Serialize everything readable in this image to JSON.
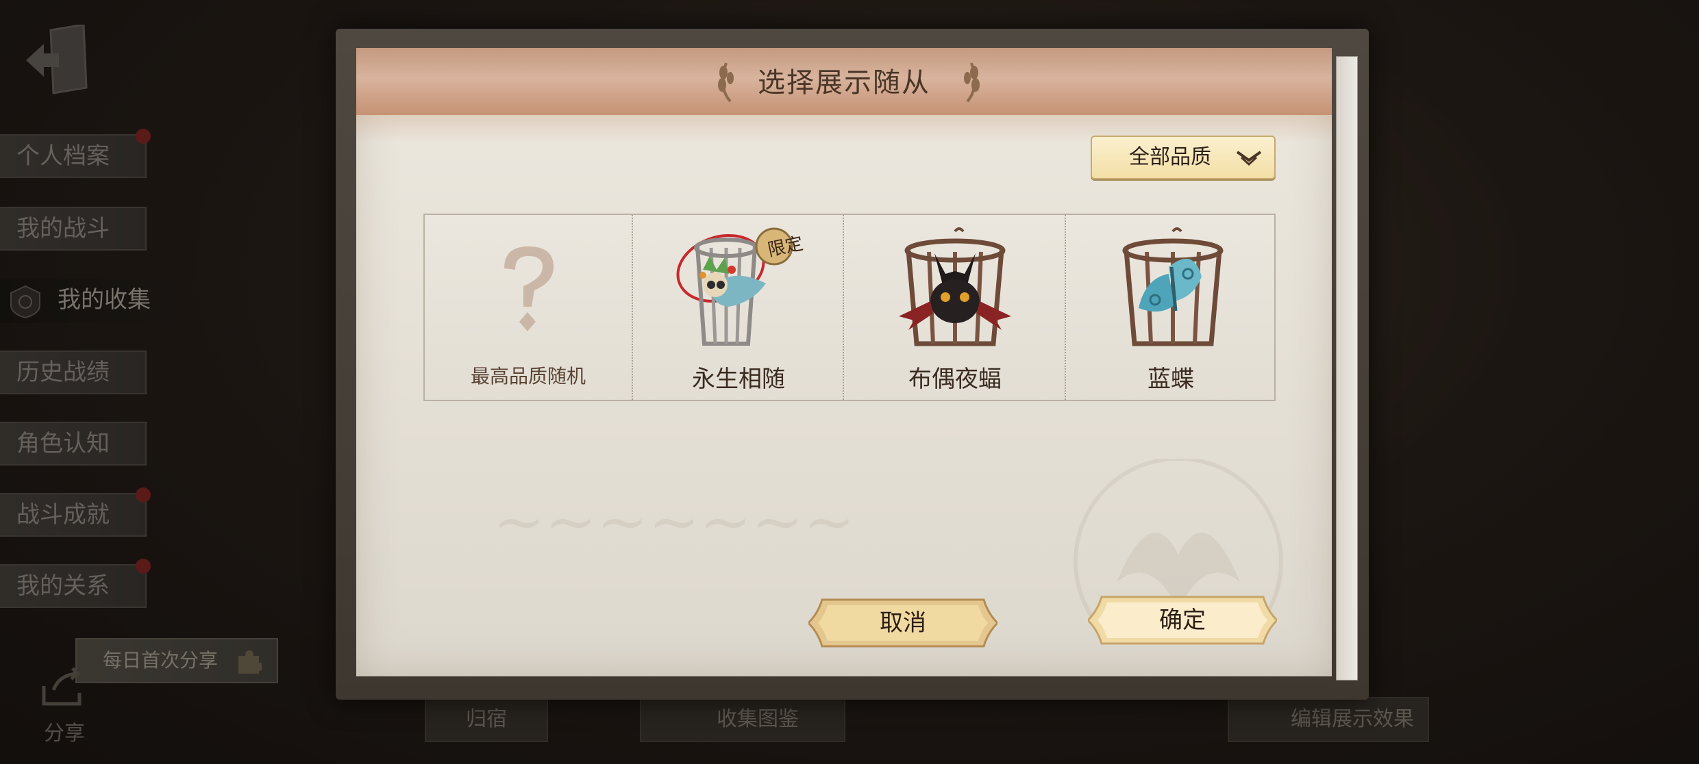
{
  "sidebar": {
    "items": [
      {
        "label": "个人档案",
        "badge": true
      },
      {
        "label": "我的战斗",
        "badge": false
      },
      {
        "label": "我的收集",
        "badge": false,
        "active": true
      },
      {
        "label": "历史战绩",
        "badge": false
      },
      {
        "label": "角色认知",
        "badge": false
      },
      {
        "label": "战斗成就",
        "badge": true
      },
      {
        "label": "我的关系",
        "badge": true
      }
    ],
    "share_banner": "每日首次分享",
    "share_label": "分享"
  },
  "bottom_bar": {
    "items": [
      "归宿",
      "收集图鉴",
      "编辑展示效果"
    ]
  },
  "dialog": {
    "title": "选择展示随从",
    "filter": {
      "selected": "全部品质"
    },
    "items": [
      {
        "label": "最高品质随机",
        "icon": "question-mark-icon"
      },
      {
        "label": "永生相随",
        "icon": "masked-bird-cage-icon",
        "tag": "限定"
      },
      {
        "label": "布偶夜蝠",
        "icon": "bat-doll-cage-icon"
      },
      {
        "label": "蓝蝶",
        "icon": "blue-butterfly-cage-icon"
      }
    ],
    "cancel_label": "取消",
    "confirm_label": "确定"
  },
  "colors": {
    "header": "#d8b39d",
    "button": "#f1d9a2",
    "badge": "#8b2a26"
  }
}
